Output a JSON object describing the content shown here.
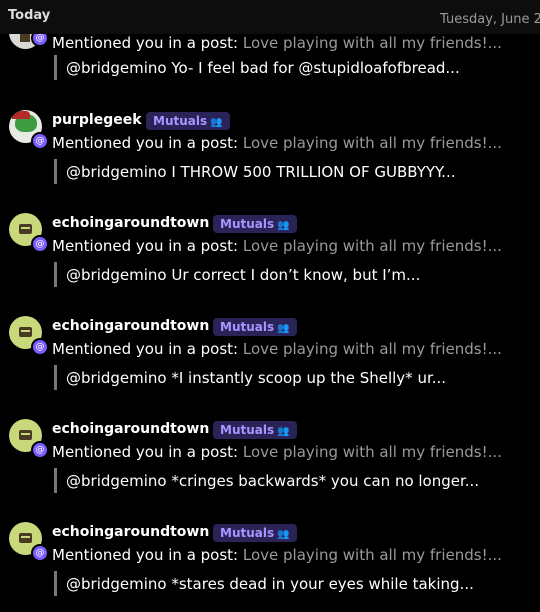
{
  "header": {
    "today_label": "Today",
    "date_label": "Tuesday, June 2"
  },
  "mutuals_label": "Mutuals",
  "notifications": [
    {
      "username": "",
      "mention_text": "Mentioned you in a post:",
      "post_preview": "Love playing with all my friends!...",
      "quote": "@bridgemino Yo- I feel bad for @stupidloafofbread..."
    },
    {
      "username": "purplegeek",
      "mention_text": "Mentioned you in a post:",
      "post_preview": "Love playing with all my friends!...",
      "quote": "@bridgemino I THROW 500 TRILLION OF GUBBYYY..."
    },
    {
      "username": "echoingaroundtown",
      "mention_text": "Mentioned you in a post:",
      "post_preview": "Love playing with all my friends!...",
      "quote": "@bridgemino Ur correct I don’t know, but I’m..."
    },
    {
      "username": "echoingaroundtown",
      "mention_text": "Mentioned you in a post:",
      "post_preview": "Love playing with all my friends!...",
      "quote": "@bridgemino *I instantly scoop up the Shelly* ur..."
    },
    {
      "username": "echoingaroundtown",
      "mention_text": "Mentioned you in a post:",
      "post_preview": "Love playing with all my friends!...",
      "quote": "@bridgemino *cringes backwards* you can no longer..."
    },
    {
      "username": "echoingaroundtown",
      "mention_text": "Mentioned you in a post:",
      "post_preview": "Love playing with all my friends!...",
      "quote": "@bridgemino *stares dead in your eyes while taking..."
    }
  ]
}
